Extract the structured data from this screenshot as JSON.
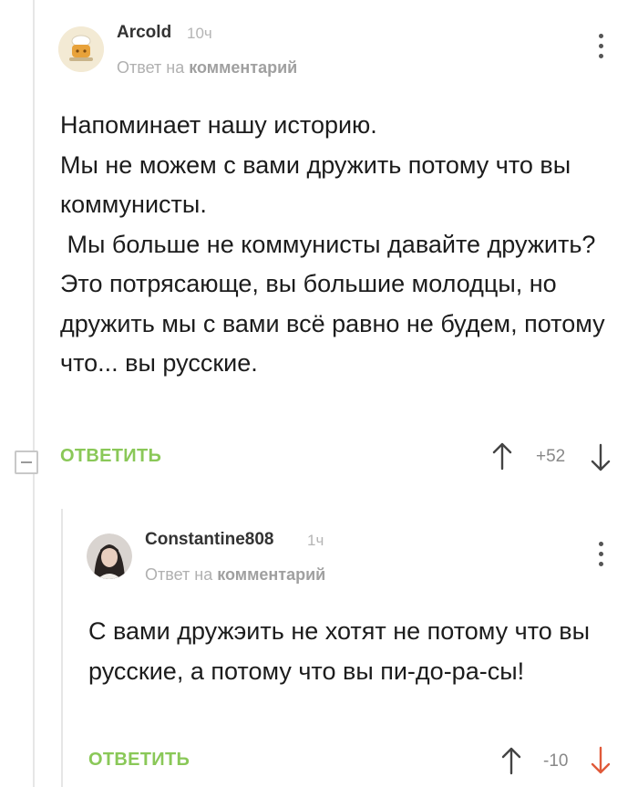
{
  "comments": [
    {
      "username": "Arcold",
      "time": "10ч",
      "reply_prefix": "Ответ на",
      "reply_link": "комментарий",
      "text": "Напоминает нашу историю.\nМы не можем с вами дружить потому что вы коммунисты.\n Мы больше не коммунисты давайте дружить?\nЭто потрясающе, вы большие молодцы, но дружить мы с вами всё равно не будем, потому что... вы русские.",
      "reply_label": "ОТВЕТИТЬ",
      "score": "+52"
    },
    {
      "username": "Constantine808",
      "time": "1ч",
      "reply_prefix": "Ответ на",
      "reply_link": "комментарий",
      "text": "С вами дружэить не хотят не потому что вы русские, а потому что вы пи-до-ра-сы!",
      "reply_label": "ОТВЕТИТЬ",
      "score": "-10"
    }
  ],
  "colors": {
    "accent_green": "#8ac858",
    "downvote_active": "#e05a3a",
    "thread_line": "#e6e6e6"
  }
}
